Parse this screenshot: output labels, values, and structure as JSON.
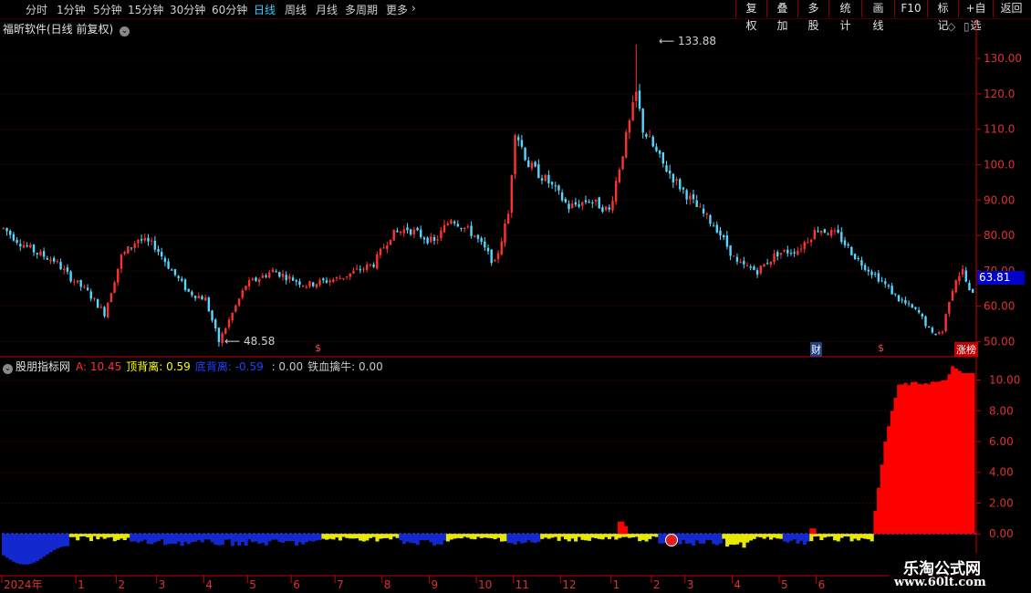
{
  "toolbar": {
    "periods": [
      "分时",
      "1分钟",
      "5分钟",
      "15分钟",
      "30分钟",
      "60分钟",
      "日线",
      "周线",
      "月线",
      "多周期",
      "更多"
    ],
    "active_period": "日线",
    "more_arrow": "›",
    "right_buttons": [
      "复权",
      "叠加",
      "多股",
      "统计",
      "画线",
      "F10",
      "标记",
      "+自选",
      "返回"
    ]
  },
  "main_panel": {
    "title": "福昕软件(日线 前复权)",
    "high_label": "133.88",
    "low_label": "48.58",
    "current_price": "63.81",
    "markers": [
      "$",
      "财",
      "$",
      "涨榜"
    ],
    "colors": {
      "up": "#ff3232",
      "down": "#54d8ff",
      "grid": "#5a0000",
      "axis": "#c80000",
      "price_box": "#0000c8"
    }
  },
  "indicator_panel": {
    "name": "股朋指标网",
    "items": [
      {
        "label": "A:",
        "value": "10.45",
        "color": "#ff3030"
      },
      {
        "label": "顶背离:",
        "value": "0.59",
        "color": "#ffff00"
      },
      {
        "label": "底背离:",
        "value": "-0.59",
        "color": "#2040ff"
      },
      {
        "label": "",
        "value": ": 0.00",
        "color": "#c8c8c8"
      },
      {
        "label": "铁血擒牛:",
        "value": "0.00",
        "color": "#c8c8c8"
      }
    ]
  },
  "xaxis": {
    "labels": [
      "2024年",
      "1",
      "2",
      "3",
      "4",
      "5",
      "6",
      "7",
      "8",
      "9",
      "10",
      "11",
      "12",
      "1",
      "2",
      "3",
      "4",
      "5",
      "6"
    ]
  },
  "watermark": {
    "line1": "乐淘公式网",
    "line2": "www.60lt.com"
  },
  "chart_data": [
    {
      "type": "candlestick",
      "title": "福昕软件(日线 前复权)",
      "y_ticks": [
        "130.00",
        "120.0",
        "110.0",
        "100.0",
        "90.00",
        "80.00",
        "70.00",
        "60.00",
        "50.00"
      ],
      "ylim": [
        46,
        138
      ],
      "high": 133.88,
      "low": 48.58,
      "last": 63.81,
      "trend": [
        [
          0,
          82
        ],
        [
          5,
          78
        ],
        [
          10,
          75
        ],
        [
          15,
          73
        ],
        [
          20,
          68
        ],
        [
          25,
          64
        ],
        [
          30,
          58
        ],
        [
          35,
          74
        ],
        [
          40,
          79
        ],
        [
          45,
          77
        ],
        [
          50,
          70
        ],
        [
          55,
          64
        ],
        [
          60,
          62
        ],
        [
          64,
          50
        ],
        [
          68,
          58
        ],
        [
          72,
          66
        ],
        [
          80,
          70
        ],
        [
          90,
          66
        ],
        [
          100,
          68
        ],
        [
          110,
          72
        ],
        [
          115,
          80
        ],
        [
          120,
          82
        ],
        [
          128,
          78
        ],
        [
          133,
          85
        ],
        [
          140,
          80
        ],
        [
          146,
          72
        ],
        [
          150,
          86
        ],
        [
          152,
          110
        ],
        [
          156,
          100
        ],
        [
          162,
          95
        ],
        [
          168,
          88
        ],
        [
          174,
          90
        ],
        [
          180,
          87
        ],
        [
          188,
          120
        ],
        [
          190,
          110
        ],
        [
          196,
          100
        ],
        [
          200,
          95
        ],
        [
          206,
          88
        ],
        [
          212,
          82
        ],
        [
          218,
          72
        ],
        [
          224,
          70
        ],
        [
          230,
          75
        ],
        [
          236,
          76
        ],
        [
          242,
          82
        ],
        [
          248,
          80
        ],
        [
          254,
          73
        ],
        [
          260,
          68
        ],
        [
          266,
          62
        ],
        [
          272,
          58
        ],
        [
          276,
          52
        ],
        [
          279,
          53
        ],
        [
          281,
          62
        ],
        [
          283,
          68
        ],
        [
          285,
          70
        ],
        [
          287,
          64
        ]
      ]
    },
    {
      "type": "bar",
      "title": "股朋指标网",
      "y_ticks": [
        "10.00",
        "8.00",
        "6.00",
        "4.00",
        "2.00",
        "0.00"
      ],
      "ylim": [
        -2.6,
        11.4
      ],
      "series": [
        {
          "name": "A:",
          "values": [
            [
              258,
              0
            ],
            [
              260,
              3
            ],
            [
              262,
              6
            ],
            [
              264,
              8
            ],
            [
              266,
              9.7
            ],
            [
              280,
              9.9
            ],
            [
              282,
              10.9
            ],
            [
              285,
              10.45
            ]
          ]
        },
        {
          "name": "顶背离:",
          "segments": [
            [
              20,
              38
            ],
            [
              95,
              118
            ],
            [
              132,
              150
            ],
            [
              160,
              195
            ],
            [
              214,
              232
            ],
            [
              240,
              262
            ]
          ],
          "value": 0.59
        },
        {
          "name": "底背离:",
          "segments": [
            [
              0,
              20
            ],
            [
              38,
              95
            ],
            [
              118,
              132
            ],
            [
              150,
              160
            ],
            [
              195,
              214
            ],
            [
              232,
              240
            ],
            [
              285,
              288
            ]
          ],
          "value": -0.59
        }
      ]
    }
  ]
}
